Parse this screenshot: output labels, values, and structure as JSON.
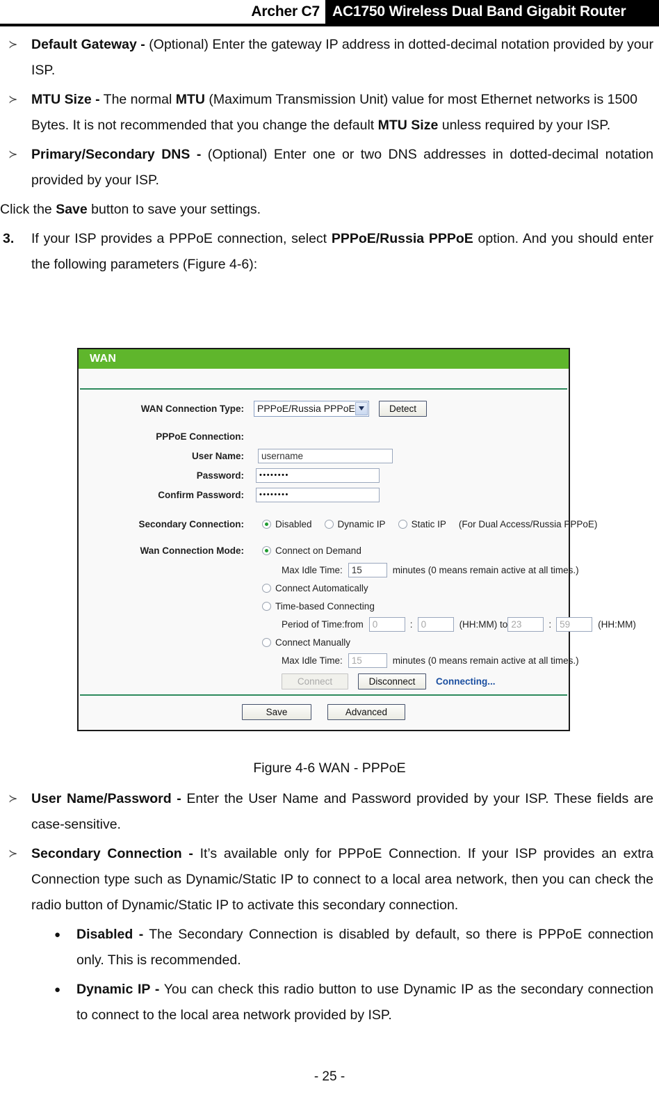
{
  "header": {
    "model": "Archer C7",
    "product_title": "AC1750 Wireless Dual Band Gigabit Router"
  },
  "upper_text": {
    "b1_label": "Default Gateway  -",
    "b1_body": " (Optional)  Enter  the  gateway  IP  address  in  dotted-decimal  notation provided by your ISP.",
    "b2_label": "MTU Size -",
    "b2_body_1": " The normal ",
    "b2_strong": "MTU",
    "b2_body_2": " (Maximum Transmission Unit) value for most Ethernet networks is 1500 Bytes. It is not recommended that you change the default ",
    "b2_strong2": "MTU Size",
    "b2_body_3": " unless required by your ISP.",
    "b3_label": "Primary/Secondary DNS -",
    "b3_body": " (Optional) Enter one or two DNS addresses in dotted-decimal notation provided by your ISP.",
    "save_line_1": "Click the ",
    "save_line_strong": "Save",
    "save_line_2": " button to save your settings.",
    "step_number": "3.",
    "step_body_1": "If  your  ISP  provides  a  PPPoE  connection,  select  ",
    "step_strong": "PPPoE/Russia  PPPoE",
    "step_body_2": "  option.  And  you should enter the following parameters (Figure 4-6):"
  },
  "panel": {
    "title": "WAN",
    "wan_connection_type_label": "WAN Connection Type:",
    "wan_connection_type_value": "PPPoE/Russia PPPoE",
    "detect_button": "Detect",
    "pppoe_connection_label": "PPPoE Connection:",
    "user_name_label": "User Name:",
    "user_name_value": "username",
    "password_label": "Password:",
    "password_value": "••••••••",
    "confirm_password_label": "Confirm Password:",
    "confirm_password_value": "••••••••",
    "secondary_connection_label": "Secondary Connection:",
    "secondary_options": [
      {
        "label": "Disabled",
        "selected": true
      },
      {
        "label": "Dynamic IP",
        "selected": false
      },
      {
        "label": "Static IP",
        "selected": false
      }
    ],
    "secondary_note": "(For Dual Access/Russia PPPoE)",
    "wan_mode_label": "Wan Connection Mode:",
    "mode_connect_on_demand": "Connect on Demand",
    "max_idle_time_label": "Max Idle Time:",
    "max_idle_time_value": "15",
    "max_idle_time_note": "minutes (0 means remain active at all times.)",
    "mode_connect_automatically": "Connect Automatically",
    "mode_time_based": "Time-based Connecting",
    "period_label": "Period of Time:from",
    "period_from_hh": "0",
    "period_from_mm": "0",
    "period_mid_note": "(HH:MM) to",
    "period_to_hh": "23",
    "period_to_mm": "59",
    "period_end_note": "(HH:MM)",
    "mode_connect_manually": "Connect Manually",
    "manual_idle_label": "Max Idle Time:",
    "manual_idle_value": "15",
    "manual_idle_note": "minutes (0 means remain active at all times.)",
    "connect_button": "Connect",
    "disconnect_button": "Disconnect",
    "status_text": "Connecting...",
    "save_button": "Save",
    "advanced_button": "Advanced",
    "colon": ":",
    "accent_green": "#5fb62c",
    "rule_green": "#2d8a5c",
    "status_blue": "#1b4fa0",
    "radio_dot_green": "#1e9b2f"
  },
  "figure_caption": "Figure 4-6 WAN - PPPoE",
  "lower_text": {
    "b4_label": "User Name/Password -",
    "b4_body": " Enter the User Name and Password provided by your ISP. These fields are case-sensitive.",
    "b5_label": "Secondary Connection -",
    "b5_body": " It’s available only for PPPoE Connection. If your ISP provides an extra Connection type such as Dynamic/Static IP to connect to a local area network, then you can check the radio button of Dynamic/Static IP to activate this secondary connection.",
    "s1_label": "Disabled  -",
    "s1_body": "  The  Secondary  Connection  is  disabled  by  default,  so  there  is  PPPoE connection only. This is recommended.",
    "s2_label": "Dynamic IP -",
    "s2_body": "  You  can  check  this  radio  button  to  use  Dynamic  IP  as  the  secondary connection to connect to the local area network provided by ISP."
  },
  "footer": {
    "page": "- 25 -"
  },
  "icons": {
    "bullet_chevron": "≻",
    "bullet_dot": "●",
    "dropdown_chevron": "chevron-down-icon"
  }
}
